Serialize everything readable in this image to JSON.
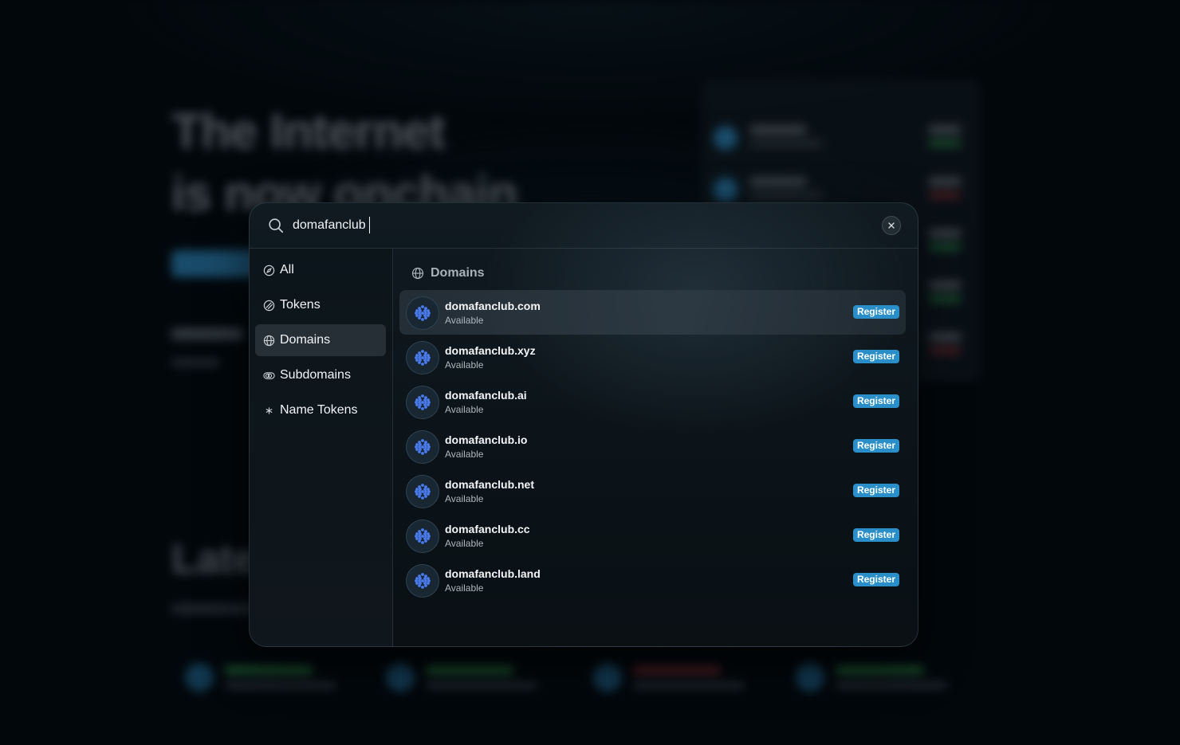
{
  "background": {
    "hero_line1": "The Internet",
    "hero_line2": "is now onchain",
    "latest_heading": "Latest"
  },
  "search": {
    "value": "domafanclub",
    "placeholder": ""
  },
  "sidebar": {
    "items": [
      {
        "label": "All",
        "icon": "compass-icon",
        "active": false
      },
      {
        "label": "Tokens",
        "icon": "token-icon",
        "active": false
      },
      {
        "label": "Domains",
        "icon": "globe-icon",
        "active": true
      },
      {
        "label": "Subdomains",
        "icon": "subdomain-icon",
        "active": false
      },
      {
        "label": "Name Tokens",
        "icon": "asterisk-icon",
        "active": false
      }
    ]
  },
  "results": {
    "section_title": "Domains",
    "section_icon": "globe-icon",
    "register_label": "Register",
    "items": [
      {
        "name": "domafanclub.com",
        "status": "Available"
      },
      {
        "name": "domafanclub.xyz",
        "status": "Available"
      },
      {
        "name": "domafanclub.ai",
        "status": "Available"
      },
      {
        "name": "domafanclub.io",
        "status": "Available"
      },
      {
        "name": "domafanclub.net",
        "status": "Available"
      },
      {
        "name": "domafanclub.cc",
        "status": "Available"
      },
      {
        "name": "domafanclub.land",
        "status": "Available"
      }
    ]
  },
  "colors": {
    "accent": "#2a8fc9",
    "domain_icon_dots": "#4a7cf0",
    "background": "#02070b"
  }
}
